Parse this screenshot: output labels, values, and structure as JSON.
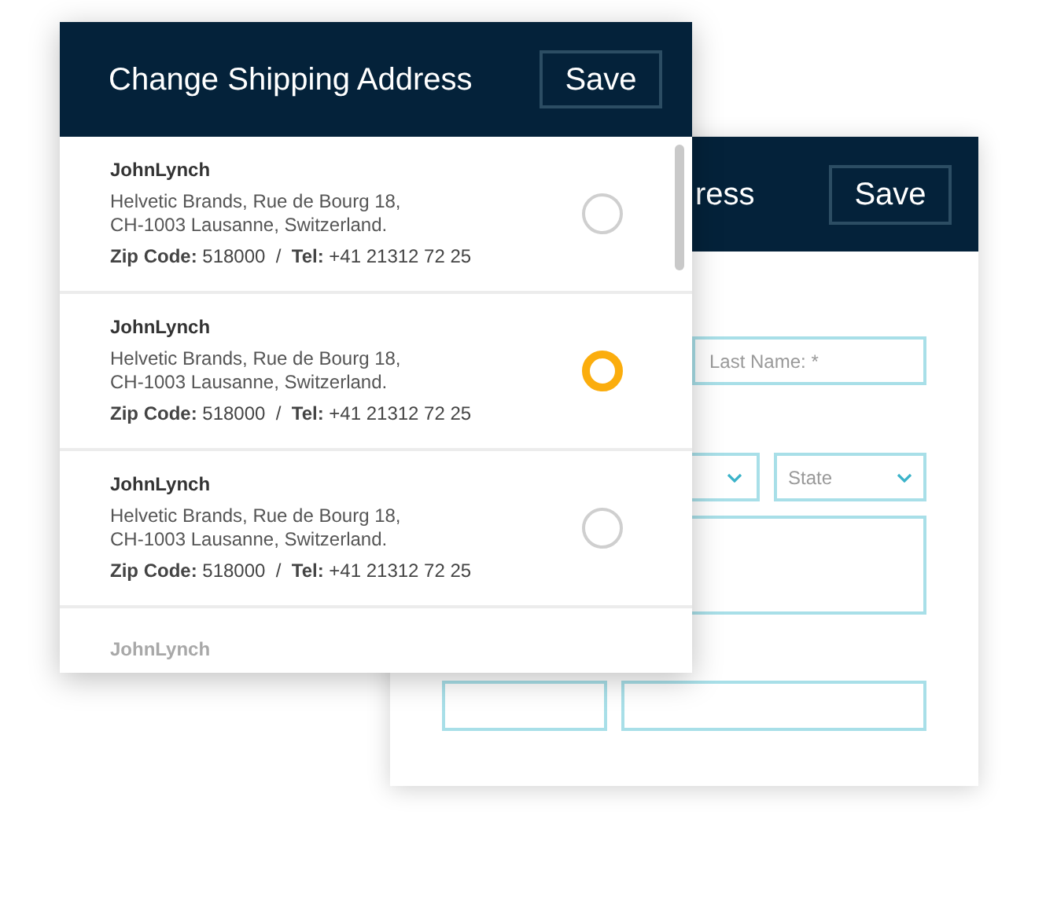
{
  "back_dialog": {
    "title": "ress",
    "save_button": "Save",
    "last_name": {
      "placeholder": "Last Name: *"
    },
    "state_select": {
      "placeholder": "State"
    }
  },
  "front_dialog": {
    "title": "Change Shipping Address",
    "save_button": "Save",
    "addresses": [
      {
        "name": "JohnLynch",
        "lines": [
          "Helvetic Brands, Rue de Bourg 18,",
          "CH-1003 Lausanne, Switzerland."
        ],
        "contact": "**Zip Code:** 518000  /  **Tel:** +41 21312 72 25",
        "selected": false
      },
      {
        "name": "JohnLynch",
        "lines": [
          "Helvetic Brands, Rue de Bourg 18,",
          "CH-1003 Lausanne, Switzerland."
        ],
        "contact": "**Zip Code:** 518000  /  **Tel:** +41 21312 72 25",
        "selected": true
      },
      {
        "name": "JohnLynch",
        "lines": [
          "Helvetic Brands, Rue de Bourg 18,",
          "CH-1003 Lausanne, Switzerland."
        ],
        "contact": "**Zip Code:** 518000  /  **Tel:** +41 21312 72 25",
        "selected": false
      }
    ],
    "partial_address": {
      "name": "JohnLynch"
    }
  }
}
